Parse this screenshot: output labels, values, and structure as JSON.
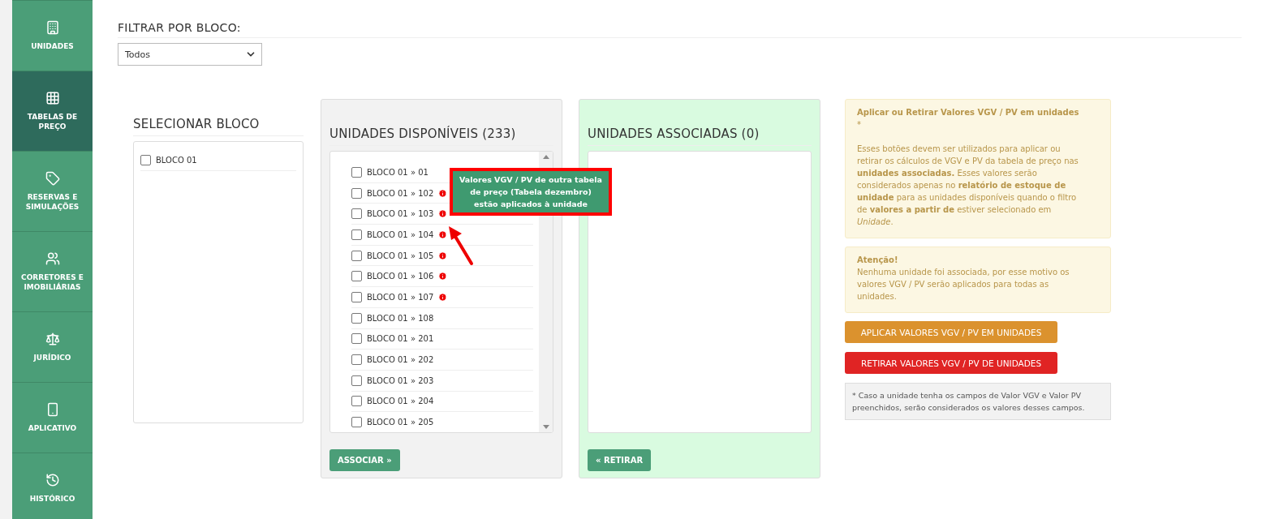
{
  "sidebar": {
    "items": [
      {
        "label": "UNIDADES",
        "selected": false
      },
      {
        "label": "TABELAS DE PREÇO",
        "selected": true
      },
      {
        "label": "RESERVAS E SIMULAÇÕES",
        "selected": false
      },
      {
        "label": "CORRETORES E IMOBILIÁRIAS",
        "selected": false
      },
      {
        "label": "JURÍDICO",
        "selected": false
      },
      {
        "label": "APLICATIVO",
        "selected": false
      },
      {
        "label": "HISTÓRICO",
        "selected": false
      }
    ]
  },
  "filter": {
    "label": "FILTRAR POR BLOCO:",
    "value": "Todos"
  },
  "blocks": {
    "title": "SELECIONAR BLOCO",
    "items": [
      {
        "label": "BLOCO 01",
        "checked": false
      }
    ]
  },
  "available": {
    "title": "UNIDADES DISPONÍVEIS (233)",
    "button": "ASSOCIAR »",
    "items": [
      {
        "label": "BLOCO 01 » 01",
        "checked": false,
        "info": false
      },
      {
        "label": "BLOCO 01 » 102",
        "checked": false,
        "info": true
      },
      {
        "label": "BLOCO 01 » 103",
        "checked": false,
        "info": true
      },
      {
        "label": "BLOCO 01 » 104",
        "checked": false,
        "info": true
      },
      {
        "label": "BLOCO 01 » 105",
        "checked": false,
        "info": true
      },
      {
        "label": "BLOCO 01 » 106",
        "checked": false,
        "info": true
      },
      {
        "label": "BLOCO 01 » 107",
        "checked": false,
        "info": true
      },
      {
        "label": "BLOCO 01 » 108",
        "checked": false,
        "info": false
      },
      {
        "label": "BLOCO 01 » 201",
        "checked": false,
        "info": false
      },
      {
        "label": "BLOCO 01 » 202",
        "checked": false,
        "info": false
      },
      {
        "label": "BLOCO 01 » 203",
        "checked": false,
        "info": false
      },
      {
        "label": "BLOCO 01 » 204",
        "checked": false,
        "info": false
      },
      {
        "label": "BLOCO 01 » 205",
        "checked": false,
        "info": false
      }
    ],
    "tooltip": "Valores VGV / PV de outra tabela de preço (Tabela dezembro) estão aplicados à unidade"
  },
  "associated": {
    "title": "UNIDADES ASSOCIADAS (0)",
    "button": "« RETIRAR"
  },
  "info_box": {
    "title": "Aplicar ou Retirar Valores VGV / PV em unidades",
    "mark": "*",
    "text": "Esses botões devem ser utilizados para aplicar ou retirar os cálculos de VGV e PV da tabela de preço nas **unidades associadas.** Esses valores serão considerados apenas no **relatório de estoque de unidade** para as unidades disponíveis quando o filtro de **valores a partir de** estiver selecionado em *Unidade*."
  },
  "warning_box": {
    "title": "Atenção!",
    "text": "Nenhuma unidade foi associada, por esse motivo os valores VGV / PV serão aplicados para todas as unidades."
  },
  "actions": [
    {
      "kind": "apply",
      "label": "APLICAR VALORES VGV / PV EM UNIDADES"
    },
    {
      "kind": "remove",
      "label": "RETIRAR VALORES VGV / PV DE UNIDADES"
    }
  ],
  "note": "* Caso a unidade tenha os campos de Valor VGV e Valor PV preenchidos, serão considerados os valores desses campos."
}
